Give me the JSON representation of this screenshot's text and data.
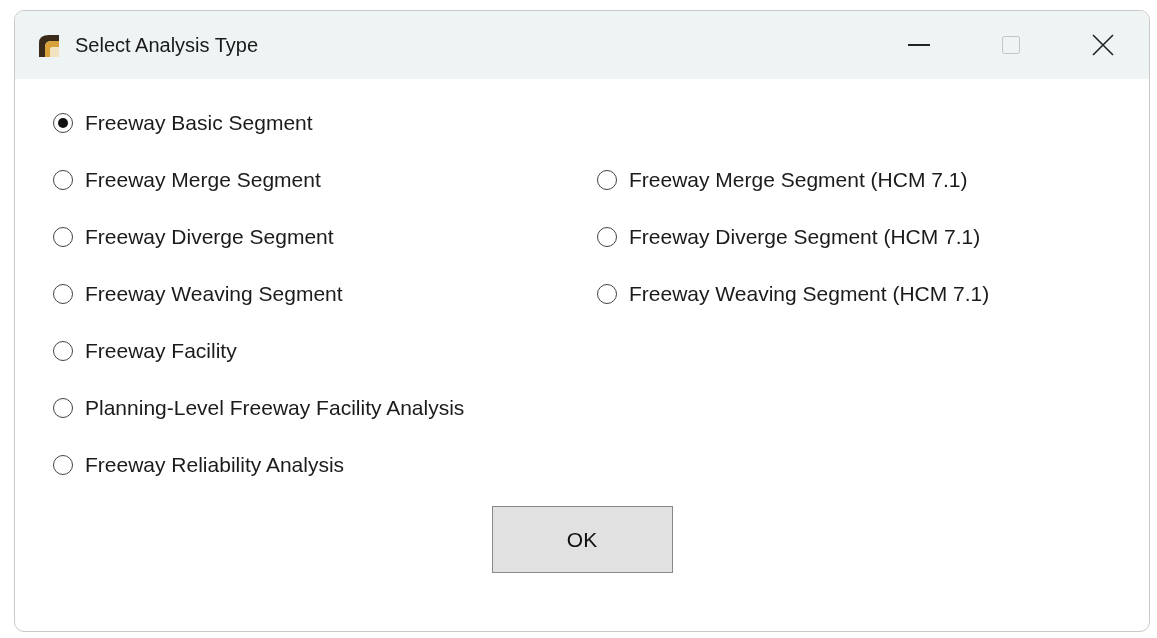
{
  "window": {
    "title": "Select Analysis Type",
    "maximize_disabled": true
  },
  "rows": [
    [
      {
        "label": "Freeway Basic Segment",
        "selected": true
      }
    ],
    [
      {
        "label": "Freeway Merge Segment",
        "selected": false
      },
      {
        "label": "Freeway Merge Segment (HCM 7.1)",
        "selected": false
      }
    ],
    [
      {
        "label": "Freeway Diverge Segment",
        "selected": false
      },
      {
        "label": "Freeway Diverge Segment (HCM 7.1)",
        "selected": false
      }
    ],
    [
      {
        "label": "Freeway Weaving Segment",
        "selected": false
      },
      {
        "label": "Freeway Weaving Segment (HCM 7.1)",
        "selected": false
      }
    ],
    [
      {
        "label": "Freeway Facility",
        "selected": false
      }
    ],
    [
      {
        "label": "Planning-Level Freeway Facility Analysis",
        "selected": false
      }
    ],
    [
      {
        "label": "Freeway Reliability Analysis",
        "selected": false
      }
    ]
  ],
  "buttons": [
    "OK"
  ]
}
